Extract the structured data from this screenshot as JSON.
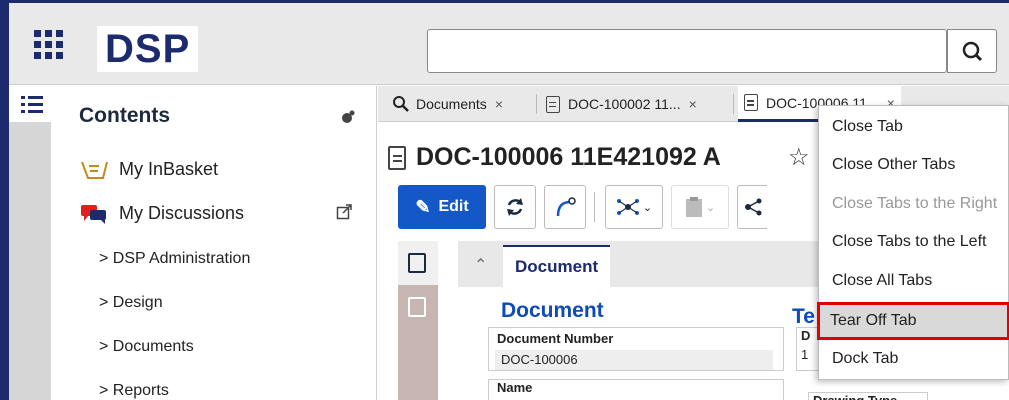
{
  "header": {
    "logo_text": "DSP",
    "search_placeholder": "",
    "icons": [
      "apps-grid-icon",
      "search-icon"
    ]
  },
  "sidebar": {
    "title": "Contents",
    "items": [
      {
        "label": "My InBasket",
        "icon": "inbasket-icon"
      },
      {
        "label": "My Discussions",
        "icon": "discussions-icon"
      }
    ],
    "tree": [
      {
        "label": "DSP Administration"
      },
      {
        "label": "Design"
      },
      {
        "label": "Documents"
      },
      {
        "label": "Reports"
      }
    ]
  },
  "tabs": [
    {
      "label": "Documents",
      "icon": "search-icon",
      "close": "×"
    },
    {
      "label": "DOC-100002 11...",
      "icon": "document-icon",
      "close": "×"
    },
    {
      "label": "DOC-100006 11...",
      "icon": "document-icon",
      "close": "×",
      "active": true
    }
  ],
  "document": {
    "title": "DOC-100006 11E421092 A",
    "star": "☆",
    "edit_label": "Edit",
    "section_tab": "Document",
    "section_title": "Document",
    "section_title_2": "Te",
    "field_label": "Document Number",
    "field_value": "DOC-100006",
    "field2_label": "D",
    "field2_value": "1",
    "name_label": "Name",
    "drawing_label": "Drawing Type"
  },
  "context_menu": {
    "items": [
      {
        "label": "Close Tab",
        "disabled": false
      },
      {
        "label": "Close Other Tabs",
        "disabled": false
      },
      {
        "label": "Close Tabs to the Right",
        "disabled": true
      },
      {
        "label": "Close Tabs to the Left",
        "disabled": false
      },
      {
        "label": "Close All Tabs",
        "disabled": false
      },
      {
        "label": "Tear Off Tab",
        "disabled": false,
        "highlighted": true
      },
      {
        "label": "Dock Tab",
        "disabled": false
      }
    ],
    "highlight_color": "#e30000"
  },
  "colors": {
    "brand_navy": "#1c2a6e",
    "edit_blue": "#1458c7",
    "section_blue": "#0d4bb8"
  }
}
